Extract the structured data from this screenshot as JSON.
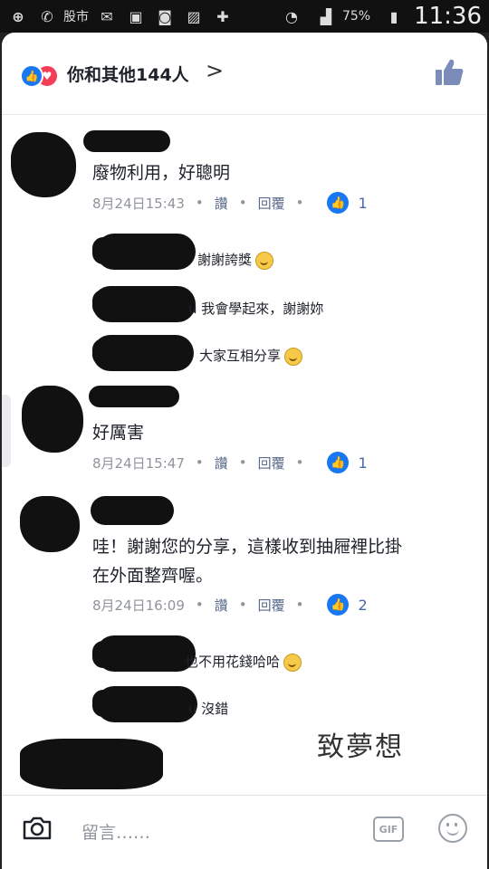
{
  "status_bar": {
    "app_label": "股市",
    "battery": "75%",
    "time": "11:36"
  },
  "header": {
    "likers": "你和其他144人"
  },
  "comments": [
    {
      "text": "廢物利用，好聰明",
      "date": "8月24日15:43",
      "like_action": "讚",
      "reply_action": "回覆",
      "likes": "1",
      "replies": [
        {
          "suffix": "謝謝誇獎"
        },
        {
          "suffix": "u 我會學起來，謝謝妳"
        },
        {
          "suffix": "大家互相分享"
        }
      ]
    },
    {
      "text": "好厲害",
      "date": "8月24日15:47",
      "like_action": "讚",
      "reply_action": "回覆",
      "likes": "1"
    },
    {
      "text_line1": "哇！謝謝您的分享，這樣收到抽屜裡比掛",
      "text_line2": "在外面整齊喔。",
      "date": "8月24日16:09",
      "like_action": "讚",
      "reply_action": "回覆",
      "likes": "2",
      "replies": [
        {
          "suffix": "也不用花錢哈哈"
        },
        {
          "suffix": "u 沒錯"
        }
      ]
    }
  ],
  "watermark": "致夢想",
  "composer": {
    "placeholder": "留言……",
    "gif_label": "GIF"
  },
  "colors": {
    "accent": "#1877f2",
    "love": "#f33e58",
    "meta_text": "#90949c"
  }
}
